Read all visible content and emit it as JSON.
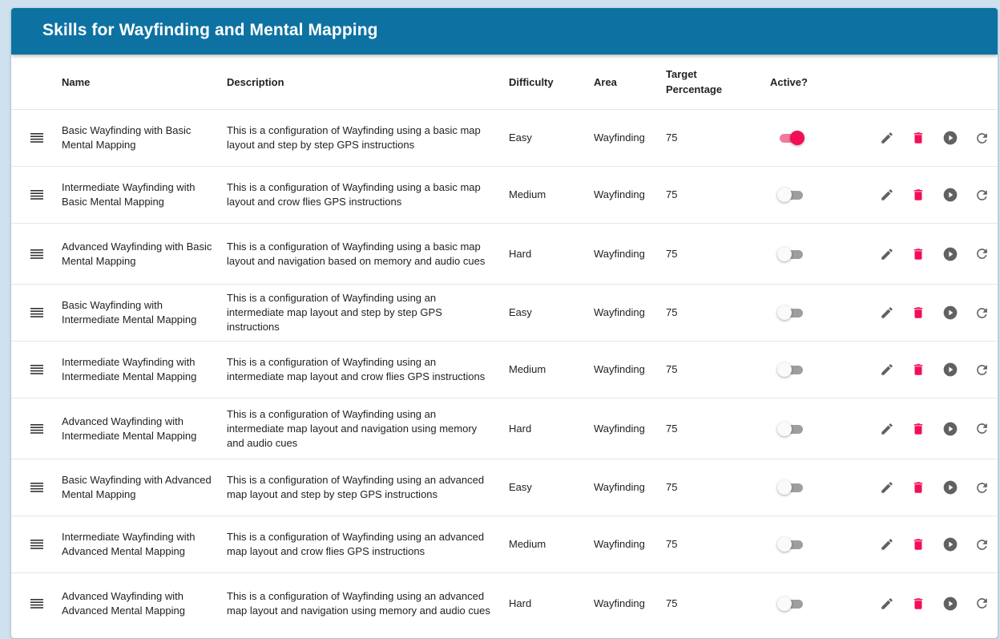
{
  "title": "Skills for Wayfinding and Mental Mapping",
  "columns": {
    "name": "Name",
    "description": "Description",
    "difficulty": "Difficulty",
    "area": "Area",
    "target_line1": "Target",
    "target_line2": "Percentage",
    "active": "Active?"
  },
  "icons": {
    "handle": "drag-handle-icon",
    "edit": "pencil-icon",
    "delete": "trash-icon",
    "play": "play-circle-icon",
    "reset": "refresh-icon"
  },
  "colors": {
    "header": "#0d72a2",
    "accent": "#f20f56",
    "icon": "#616161"
  },
  "rows": [
    {
      "name": "Basic Wayfinding with Basic Mental Mapping",
      "description": "This is a configuration of Wayfinding using a basic map layout and step by step GPS instructions",
      "difficulty": "Easy",
      "area": "Wayfinding",
      "target": "75",
      "active": true
    },
    {
      "name": "Intermediate Wayfinding with Basic Mental Mapping",
      "description": "This is a configuration of Wayfinding using a basic map layout and crow flies GPS instructions",
      "difficulty": "Medium",
      "area": "Wayfinding",
      "target": "75",
      "active": false
    },
    {
      "name": "Advanced Wayfinding with Basic Mental Mapping",
      "description": "This is a configuration of Wayfinding using a basic map layout and navigation based on memory and audio cues",
      "difficulty": "Hard",
      "area": "Wayfinding",
      "target": "75",
      "active": false
    },
    {
      "name": "Basic Wayfinding with Intermediate Mental Mapping",
      "description": "This is a configuration of Wayfinding using an intermediate map layout and step by step GPS instructions",
      "difficulty": "Easy",
      "area": "Wayfinding",
      "target": "75",
      "active": false
    },
    {
      "name": "Intermediate Wayfinding with Intermediate Mental Mapping",
      "description": "This is a configuration of Wayfinding using an intermediate map layout and crow flies GPS instructions",
      "difficulty": "Medium",
      "area": "Wayfinding",
      "target": "75",
      "active": false
    },
    {
      "name": "Advanced Wayfinding with Intermediate Mental Mapping",
      "description": "This is a configuration of Wayfinding using an intermediate map layout and navigation using memory and audio cues",
      "difficulty": "Hard",
      "area": "Wayfinding",
      "target": "75",
      "active": false
    },
    {
      "name": "Basic Wayfinding with Advanced Mental Mapping",
      "description": "This is a configuration of Wayfinding using an advanced map layout and step by step GPS instructions",
      "difficulty": "Easy",
      "area": "Wayfinding",
      "target": "75",
      "active": false
    },
    {
      "name": "Intermediate Wayfinding with Advanced Mental Mapping",
      "description": "This is a configuration of Wayfinding using an advanced map layout and crow flies GPS instructions",
      "difficulty": "Medium",
      "area": "Wayfinding",
      "target": "75",
      "active": false
    },
    {
      "name": "Advanced Wayfinding with Advanced Mental Mapping",
      "description": "This is a configuration of Wayfinding using an advanced map layout and navigation using memory and audio cues",
      "difficulty": "Hard",
      "area": "Wayfinding",
      "target": "75",
      "active": false
    }
  ]
}
